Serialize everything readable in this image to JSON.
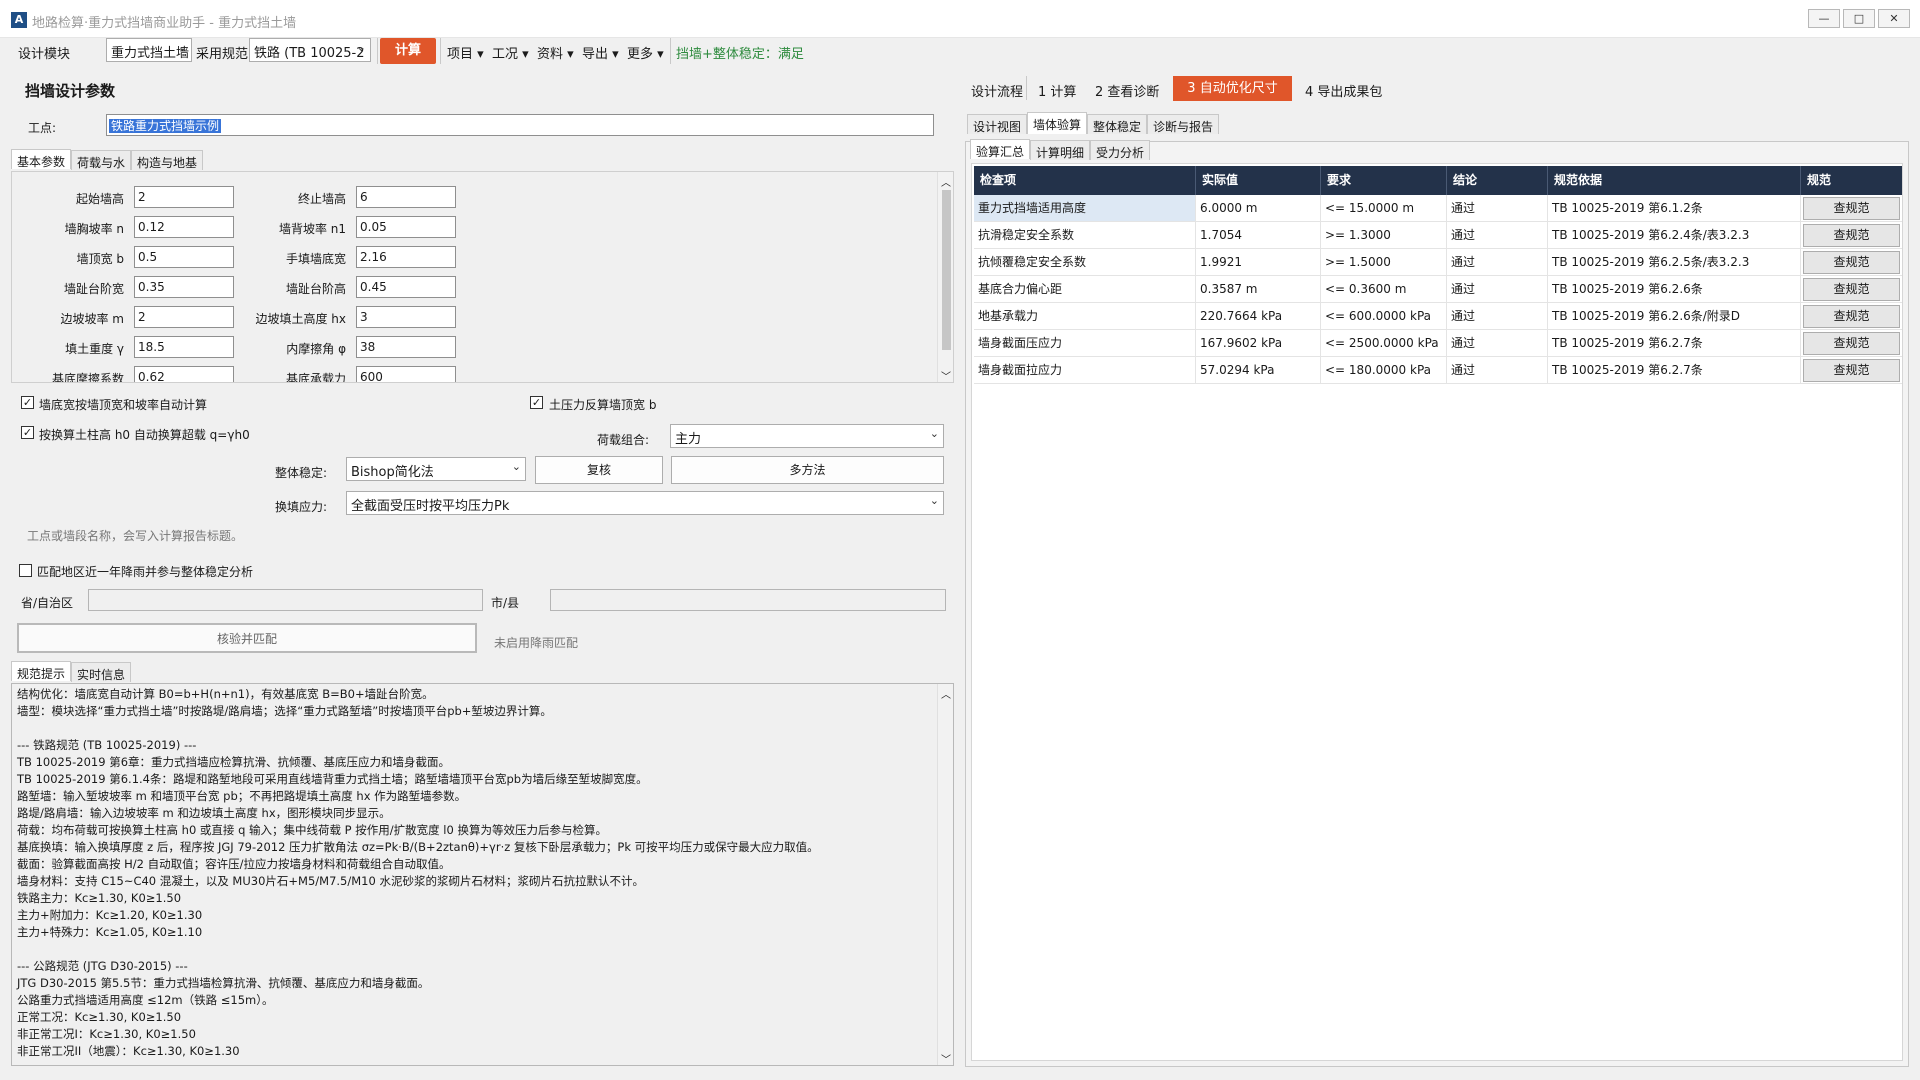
{
  "window": {
    "title": "地路检算·重力式挡墙商业助手 - 重力式挡土墙",
    "minimize": "—",
    "maximize": "□",
    "close": "✕"
  },
  "toolbar": {
    "module_label": "设计模块",
    "module_value": "重力式挡土墙",
    "code_label": "采用规范",
    "code_value": "铁路 (TB 10025-2",
    "calc_button": "计算",
    "menus": [
      "项目",
      "工况",
      "资料",
      "导出",
      "更多"
    ],
    "status": "挡墙+整体稳定：满足"
  },
  "left": {
    "title": "挡墙设计参数",
    "site_label": "工点:",
    "site_value": "铁路重力式挡墙示例",
    "tabs": [
      "基本参数",
      "荷载与水",
      "构造与地基"
    ],
    "params": [
      {
        "label": "起始墙高",
        "value": "2"
      },
      {
        "label": "终止墙高",
        "value": "6"
      },
      {
        "label": "墙胸坡率 n",
        "value": "0.12"
      },
      {
        "label": "墙背坡率 n1",
        "value": "0.05"
      },
      {
        "label": "墙顶宽 b",
        "value": "0.5"
      },
      {
        "label": "手填墙底宽",
        "value": "2.16"
      },
      {
        "label": "墙趾台阶宽",
        "value": "0.35"
      },
      {
        "label": "墙趾台阶高",
        "value": "0.45"
      },
      {
        "label": "边坡坡率 m",
        "value": "2"
      },
      {
        "label": "边坡填土高度 hx",
        "value": "3"
      },
      {
        "label": "填土重度 γ",
        "value": "18.5"
      },
      {
        "label": "内摩擦角 φ",
        "value": "38"
      },
      {
        "label": "基底摩擦系数",
        "value": "0.62"
      },
      {
        "label": "基底承载力",
        "value": "600"
      }
    ],
    "chk_auto_width": "墙底宽按墙顶宽和坡率自动计算",
    "chk_earth_pressure": "土压力反算墙顶宽 b",
    "chk_soil_column": "按换算土柱高 h0 自动换算超载 q=γh0",
    "load_combo_label": "荷载组合:",
    "load_combo_value": "主力",
    "stability_label": "整体稳定:",
    "stability_value": "Bishop简化法",
    "recheck_button": "复核",
    "multi_button": "多方法",
    "replace_stress_label": "换填应力:",
    "replace_stress_value": "全截面受压时按平均压力Pk",
    "hint": "工点或墙段名称，会写入计算报告标题。",
    "rain_check": "匹配地区近一年降雨并参与整体稳定分析",
    "province_label": "省/自治区",
    "city_label": "市/县",
    "match_button": "核验并匹配",
    "rain_status": "未启用降雨匹配",
    "note_tabs": [
      "规范提示",
      "实时信息"
    ],
    "notes": [
      "结构优化：墙底宽自动计算 B0=b+H(n+n1)，有效基底宽 B=B0+墙趾台阶宽。",
      "墙型：模块选择“重力式挡土墙”时按路堤/路肩墙；选择“重力式路堑墙”时按墙顶平台pb+堑坡边界计算。",
      "",
      "--- 铁路规范 (TB 10025-2019) ---",
      "TB 10025-2019 第6章：重力式挡墙应检算抗滑、抗倾覆、基底压应力和墙身截面。",
      "TB 10025-2019 第6.1.4条：路堤和路堑地段可采用直线墙背重力式挡土墙；路堑墙墙顶平台宽pb为墙后缘至堑坡脚宽度。",
      "路堑墙：输入堑坡坡率 m 和墙顶平台宽 pb；不再把路堤填土高度 hx 作为路堑墙参数。",
      "路堤/路肩墙：输入边坡坡率 m 和边坡填土高度 hx，图形模块同步显示。",
      "荷载：均布荷载可按换算土柱高 h0 或直接 q 输入；集中线荷载 P 按作用/扩散宽度 l0 换算为等效压力后参与检算。",
      "基底换填：输入换填厚度 z 后，程序按 JGJ 79-2012 压力扩散角法 σz=Pk·B/(B+2ztanθ)+γr·z 复核下卧层承载力；Pk 可按平均压力或保守最大应力取值。",
      "截面：验算截面高按 H/2 自动取值；容许压/拉应力按墙身材料和荷载组合自动取值。",
      "墙身材料：支持 C15~C40 混凝土，以及 MU30片石+M5/M7.5/M10 水泥砂浆的浆砌片石材料；浆砌片石抗拉默认不计。",
      "铁路主力：Kc≥1.30, K0≥1.50",
      "主力+附加力：Kc≥1.20, K0≥1.30",
      "主力+特殊力：Kc≥1.05, K0≥1.10",
      "",
      "--- 公路规范 (JTG D30-2015) ---",
      "JTG D30-2015 第5.5节：重力式挡墙检算抗滑、抗倾覆、基底应力和墙身截面。",
      "公路重力式挡墙适用高度 ≤12m（铁路 ≤15m）。",
      "正常工况：Kc≥1.30, K0≥1.50",
      "非正常工况I：Kc≥1.30, K0≥1.50",
      "非正常工况II（地震）：Kc≥1.30, K0≥1.30"
    ]
  },
  "right": {
    "flow_label": "设计流程",
    "steps": [
      "1  计算",
      "2  查看诊断",
      "3  自动优化尺寸",
      "4  导出成果包"
    ],
    "view_tabs": [
      "设计视图",
      "墙体验算",
      "整体稳定",
      "诊断与报告"
    ],
    "sub_tabs": [
      "验算汇总",
      "计算明细",
      "受力分析"
    ],
    "columns": [
      "检查项",
      "实际值",
      "要求",
      "结论",
      "规范依据",
      "规范"
    ],
    "rows": [
      {
        "item": "重力式挡墙适用高度",
        "value": "6.0000 m",
        "req": "<= 15.0000 m",
        "result": "通过",
        "basis": "TB 10025-2019 第6.1.2条",
        "btn": "查规范"
      },
      {
        "item": "抗滑稳定安全系数",
        "value": "1.7054",
        "req": ">= 1.3000",
        "result": "通过",
        "basis": "TB 10025-2019 第6.2.4条/表3.2.3",
        "btn": "查规范"
      },
      {
        "item": "抗倾覆稳定安全系数",
        "value": "1.9921",
        "req": ">= 1.5000",
        "result": "通过",
        "basis": "TB 10025-2019 第6.2.5条/表3.2.3",
        "btn": "查规范"
      },
      {
        "item": "基底合力偏心距",
        "value": "0.3587 m",
        "req": "<= 0.3600 m",
        "result": "通过",
        "basis": "TB 10025-2019 第6.2.6条",
        "btn": "查规范"
      },
      {
        "item": "地基承载力",
        "value": "220.7664 kPa",
        "req": "<= 600.0000 kPa",
        "result": "通过",
        "basis": "TB 10025-2019 第6.2.6条/附录D",
        "btn": "查规范"
      },
      {
        "item": "墙身截面压应力",
        "value": "167.9602 kPa",
        "req": "<= 2500.0000 kPa",
        "result": "通过",
        "basis": "TB 10025-2019 第6.2.7条",
        "btn": "查规范"
      },
      {
        "item": "墙身截面拉应力",
        "value": "57.0294 kPa",
        "req": "<= 180.0000 kPa",
        "result": "通过",
        "basis": "TB 10025-2019 第6.2.7条",
        "btn": "查规范"
      }
    ]
  },
  "colors": {
    "accent": "#e0562a",
    "header": "#23324a",
    "ok": "#2e8b3e",
    "selection": "#3874d8"
  }
}
